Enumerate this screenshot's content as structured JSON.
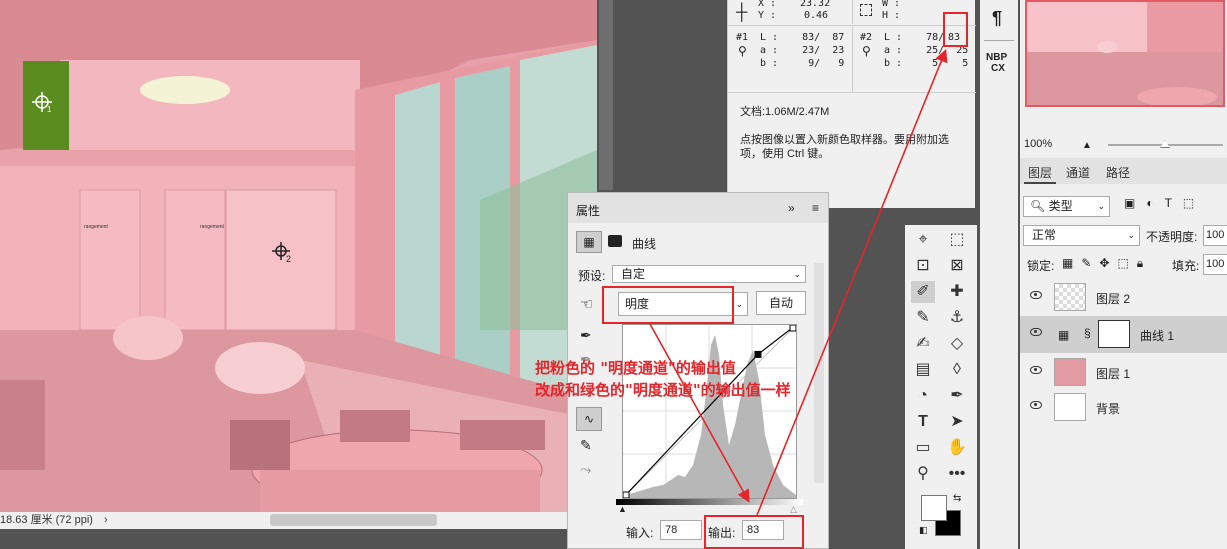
{
  "canvas": {
    "door_label_1": "rangement",
    "door_label_2": "rangement",
    "sampler_1": "1",
    "sampler_2": "2",
    "status": "18.63 厘米 (72 ppi)",
    "status_arrow": "›"
  },
  "info": {
    "x_label": "X :",
    "x_value": "23.32",
    "y_label": "Y :",
    "y_value": "0.46",
    "w_label": "W :",
    "h_label": "H :",
    "s1_id": "#1",
    "s1_l": "L :    83/  87",
    "s1_a": "a :    23/  23",
    "s1_b": "b :     9/   9",
    "s2_id": "#2",
    "s2_l": "L :    78/",
    "s2_l_out": "83",
    "s2_a": "a :    25/  25",
    "s2_b": "b :     5/   5",
    "doc_size": "文档:1.06M/2.47M",
    "hint": "点按图像以置入新颜色取样器。要用附加选项，使用 Ctrl 键。"
  },
  "icon_strip": {
    "para": "¶",
    "nbp1": "NBP",
    "nbp2": "CX"
  },
  "navigator": {
    "zoom": "100%"
  },
  "layers": {
    "tabs": [
      "图层",
      "通道",
      "路径"
    ],
    "filter_label": "类型",
    "blend_mode": "正常",
    "opacity_label": "不透明度:",
    "opacity_value": "100",
    "lock_label": "锁定:",
    "fill_label": "填充:",
    "fill_value": "100",
    "items": [
      {
        "name": "图层 2"
      },
      {
        "name": "曲线 1"
      },
      {
        "name": "图层 1"
      },
      {
        "name": "背景"
      }
    ]
  },
  "properties": {
    "tab_title": "属性",
    "adj_title": "曲线",
    "preset_label": "预设:",
    "preset_value": "自定",
    "channel_value": "明度",
    "auto_button": "自动",
    "input_label": "输入:",
    "input_value": "78",
    "output_label": "输出:",
    "output_value": "83",
    "curve_points": [
      [
        0,
        0
      ],
      [
        78,
        83
      ],
      [
        100,
        100
      ]
    ]
  },
  "annotation": {
    "line1": "把粉色的 \"明度通道\"的输出值",
    "line2": "改成和绿色的\"明度通道\"的输出值一样"
  },
  "colors": {
    "accent_red": "#e6252a",
    "sampler_green": "#5b8c1f",
    "canvas_pink": "#e7a1a8"
  }
}
